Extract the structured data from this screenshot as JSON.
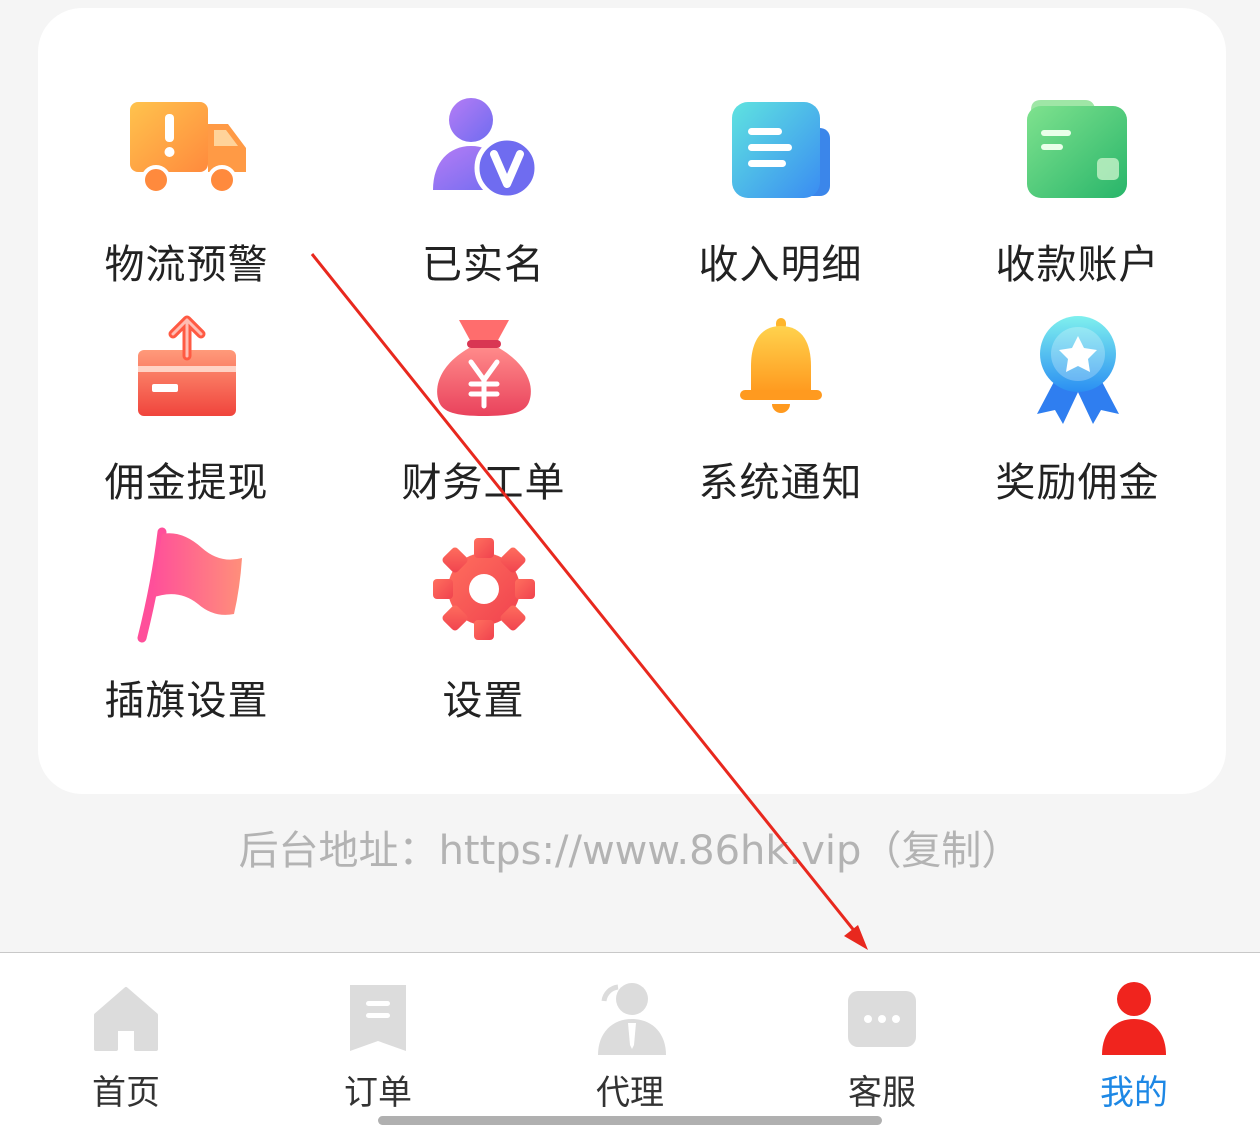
{
  "menu": {
    "items": [
      {
        "label": "物流预警",
        "icon": "truck-alert-icon"
      },
      {
        "label": "已实名",
        "icon": "verified-user-icon"
      },
      {
        "label": "收入明细",
        "icon": "document-icon"
      },
      {
        "label": "收款账户",
        "icon": "wallet-card-icon"
      },
      {
        "label": "佣金提现",
        "icon": "withdraw-box-icon"
      },
      {
        "label": "财务工单",
        "icon": "money-bag-icon"
      },
      {
        "label": "系统通知",
        "icon": "bell-icon"
      },
      {
        "label": "奖励佣金",
        "icon": "award-badge-icon"
      },
      {
        "label": "插旗设置",
        "icon": "flag-icon"
      },
      {
        "label": "设置",
        "icon": "gear-icon"
      }
    ]
  },
  "backend": {
    "prefix": "后台地址：",
    "url": "https://www.86hk.vip",
    "copy_label": "（复制）"
  },
  "tabbar": {
    "items": [
      {
        "label": "首页",
        "icon": "home-icon"
      },
      {
        "label": "订单",
        "icon": "order-icon"
      },
      {
        "label": "代理",
        "icon": "agent-icon"
      },
      {
        "label": "客服",
        "icon": "chat-icon"
      },
      {
        "label": "我的",
        "icon": "user-icon"
      }
    ],
    "active_index": 4
  },
  "colors": {
    "active_tab": "#1e88e5",
    "annotation_arrow": "#e8281e",
    "inactive_icon": "#dcdcdc"
  }
}
